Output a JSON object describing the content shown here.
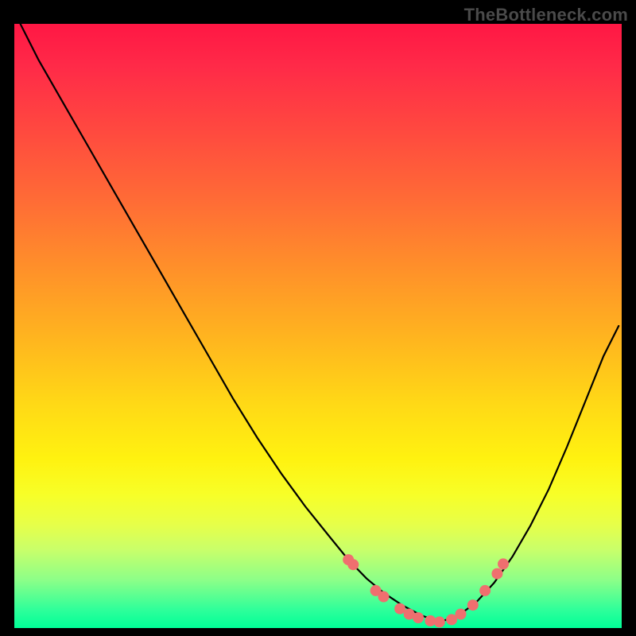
{
  "watermark": "TheBottleneck.com",
  "colors": {
    "background": "#000000",
    "dot": "#ef6f6f",
    "curve": "#000000"
  },
  "chart_data": {
    "type": "line",
    "title": "",
    "xlabel": "",
    "ylabel": "",
    "xlim": [
      0,
      100
    ],
    "ylim": [
      0,
      100
    ],
    "grid": false,
    "legend": false,
    "left_curve": {
      "x": [
        1,
        4,
        8,
        12,
        16,
        20,
        24,
        28,
        32,
        36,
        40,
        44,
        48,
        52,
        55,
        58,
        61,
        64,
        67,
        70
      ],
      "y": [
        100,
        94,
        87,
        80,
        73,
        66,
        59,
        52,
        45,
        38,
        31.5,
        25.5,
        20,
        15,
        11.3,
        8.2,
        5.7,
        3.7,
        2.1,
        1.0
      ]
    },
    "right_curve": {
      "x": [
        70,
        73,
        76,
        79,
        82,
        85,
        88,
        91,
        94,
        97,
        99.5
      ],
      "y": [
        1.0,
        2.0,
        4.2,
        7.5,
        11.8,
        17.0,
        23.0,
        30.0,
        37.5,
        45.0,
        50.0
      ]
    },
    "dots": {
      "x": [
        55.0,
        55.8,
        59.5,
        60.8,
        63.5,
        65.0,
        66.5,
        68.5,
        70.0,
        72.0,
        73.5,
        75.5,
        77.5,
        79.5,
        80.5
      ],
      "y": [
        11.3,
        10.5,
        6.2,
        5.2,
        3.2,
        2.3,
        1.7,
        1.2,
        1.0,
        1.4,
        2.3,
        3.8,
        6.2,
        9.0,
        10.6
      ]
    }
  }
}
